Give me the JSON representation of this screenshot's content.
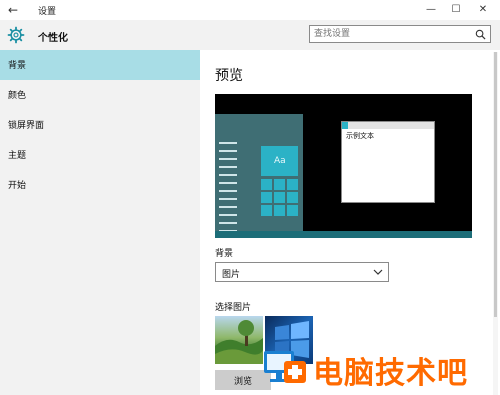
{
  "window": {
    "title": "设置",
    "back_icon": "arrow-left-icon",
    "controls": [
      "minimize-icon",
      "maximize-icon",
      "close-icon"
    ]
  },
  "header": {
    "title": "个性化",
    "icon": "gear-icon",
    "search_placeholder": "查找设置",
    "search_icon": "search-icon"
  },
  "sidebar": {
    "items": [
      {
        "label": "背景",
        "active": true
      },
      {
        "label": "颜色",
        "active": false
      },
      {
        "label": "锁屏界面",
        "active": false
      },
      {
        "label": "主题",
        "active": false
      },
      {
        "label": "开始",
        "active": false
      }
    ]
  },
  "main": {
    "preview_heading": "预览",
    "preview": {
      "tile_label": "Aa",
      "sample_text": "示例文本"
    },
    "background_label": "背景",
    "background_value": "图片",
    "choose_picture_label": "选择图片",
    "browse_label": "浏览"
  },
  "watermark": {
    "text": "电脑技术吧"
  },
  "colors": {
    "accent": "#2bb2c6",
    "sidebar_active": "#a8dde6",
    "sidebar_bg": "#f2f2f2",
    "watermark": "#ff6a00"
  }
}
